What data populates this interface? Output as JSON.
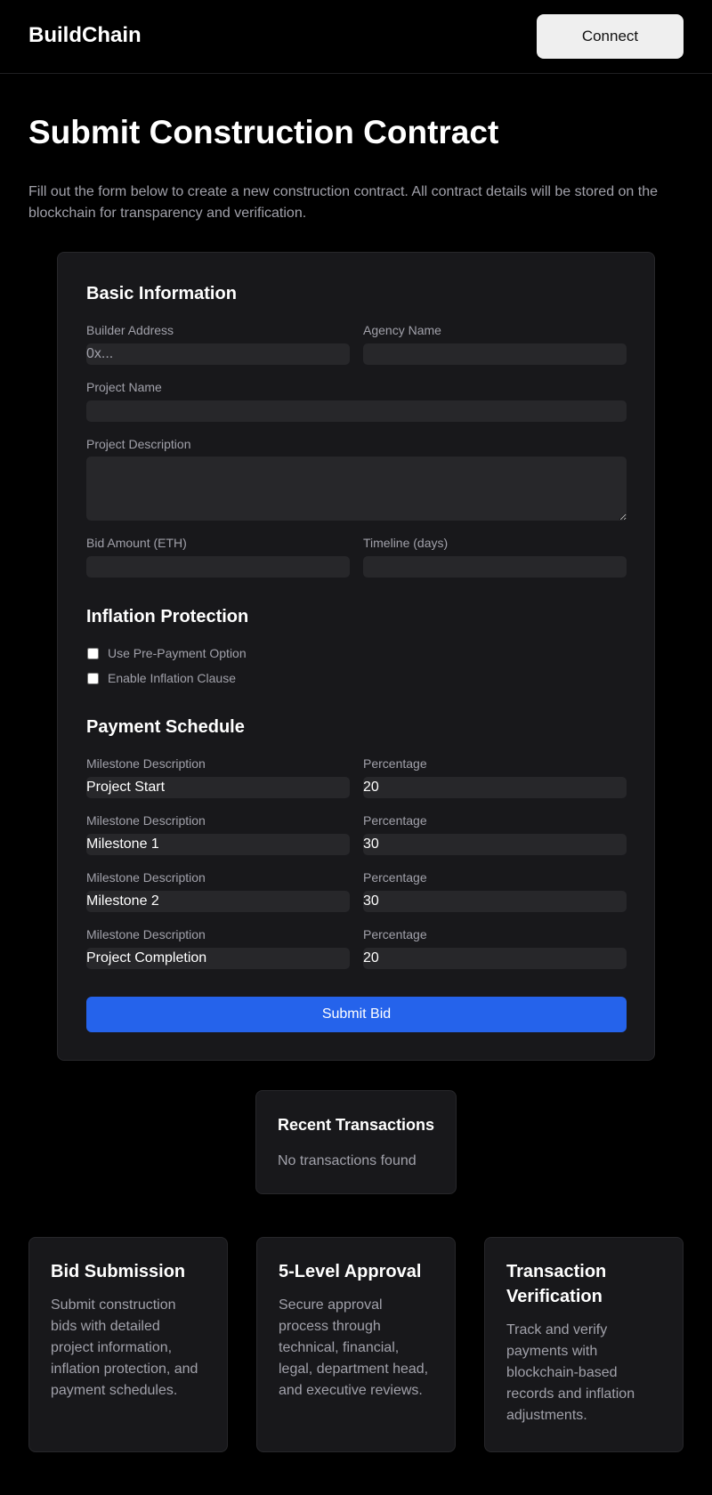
{
  "header": {
    "brand": "BuildChain",
    "connect_label": "Connect"
  },
  "intro": {
    "title": "Submit Construction Contract",
    "text": "Fill out the form below to create a new construction contract. All contract details will be stored on the blockchain for transparency and verification."
  },
  "form": {
    "basic": {
      "heading": "Basic Information",
      "builder_label": "Builder Address",
      "builder_placeholder": "0x...",
      "agency_label": "Agency Name",
      "project_name_label": "Project Name",
      "description_label": "Project Description",
      "bid_label": "Bid Amount (ETH)",
      "timeline_label": "Timeline (days)"
    },
    "inflation": {
      "heading": "Inflation Protection",
      "prepayment_label": "Use Pre-Payment Option",
      "clause_label": "Enable Inflation Clause"
    },
    "schedule": {
      "heading": "Payment Schedule",
      "milestones": [
        {
          "desc_label": "Milestone Description",
          "pct_label": "Percentage",
          "desc": "Project Start",
          "pct": "20"
        },
        {
          "desc_label": "Milestone Description",
          "pct_label": "Percentage",
          "desc": "Milestone 1",
          "pct": "30"
        },
        {
          "desc_label": "Milestone Description",
          "pct_label": "Percentage",
          "desc": "Milestone 2",
          "pct": "30"
        },
        {
          "desc_label": "Milestone Description",
          "pct_label": "Percentage",
          "desc": "Project Completion",
          "pct": "20"
        }
      ]
    },
    "submit_label": "Submit Bid"
  },
  "transactions": {
    "title": "Recent Transactions",
    "empty": "No transactions found"
  },
  "features": [
    {
      "title": "Bid Submission",
      "text": "Submit construction bids with detailed project information, inflation protection, and payment schedules."
    },
    {
      "title": "5-Level Approval",
      "text": "Secure approval process through technical, financial, legal, department head, and executive reviews."
    },
    {
      "title": "Transaction Verification",
      "text": "Track and verify payments with blockchain-based records and inflation adjustments."
    }
  ],
  "colors": {
    "background": "#000000",
    "card": "#18181b",
    "input": "#27272a",
    "accent": "#2563eb",
    "muted_text": "#a1a1aa"
  }
}
